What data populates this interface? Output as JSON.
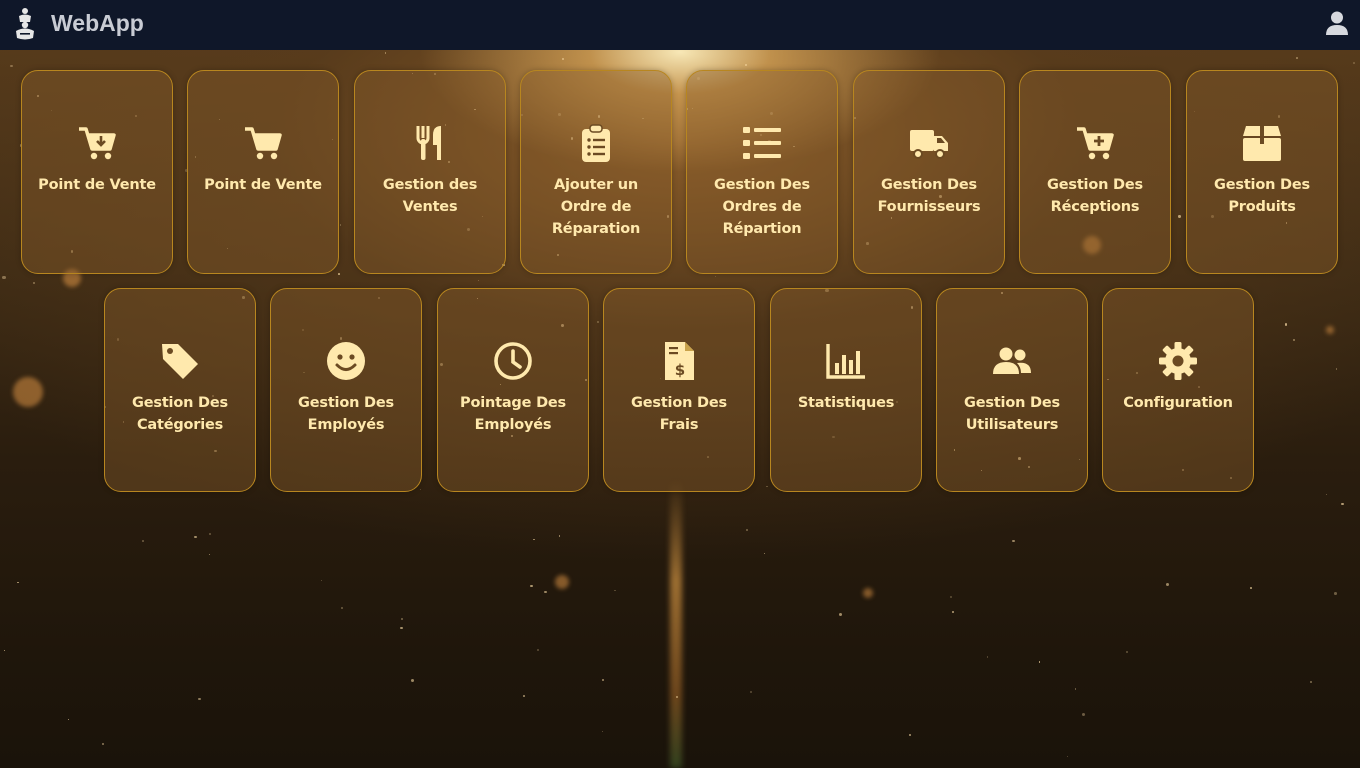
{
  "navbar": {
    "brand": "WebApp",
    "logo_icon": "chef-logo-icon",
    "user_icon": "user-icon"
  },
  "tiles_row1": [
    {
      "label": "Point de Vente",
      "icon": "cart-download-icon"
    },
    {
      "label": "Point de Vente",
      "icon": "cart-icon"
    },
    {
      "label": "Gestion des Ventes",
      "icon": "utensils-icon"
    },
    {
      "label": "Ajouter un Ordre de Réparation",
      "icon": "clipboard-list-icon"
    },
    {
      "label": "Gestion Des Ordres de Répartion",
      "icon": "list-icon"
    },
    {
      "label": "Gestion Des Fournisseurs",
      "icon": "truck-icon"
    },
    {
      "label": "Gestion Des Réceptions",
      "icon": "cart-plus-icon"
    },
    {
      "label": "Gestion Des Produits",
      "icon": "box-icon"
    }
  ],
  "tiles_row2": [
    {
      "label": "Gestion Des Catégories",
      "icon": "tag-icon"
    },
    {
      "label": "Gestion Des Employés",
      "icon": "smile-icon"
    },
    {
      "label": "Pointage Des Employés",
      "icon": "clock-icon"
    },
    {
      "label": "Gestion Des Frais",
      "icon": "invoice-dollar-icon"
    },
    {
      "label": "Statistiques",
      "icon": "chart-bar-icon"
    },
    {
      "label": "Gestion Des Utilisateurs",
      "icon": "users-icon"
    },
    {
      "label": "Configuration",
      "icon": "gear-icon"
    }
  ],
  "colors": {
    "navbar_bg": "#0f1729",
    "tile_border": "#b8861f",
    "tile_text": "#ffe9ad",
    "brand_text": "#c9ccd4"
  }
}
